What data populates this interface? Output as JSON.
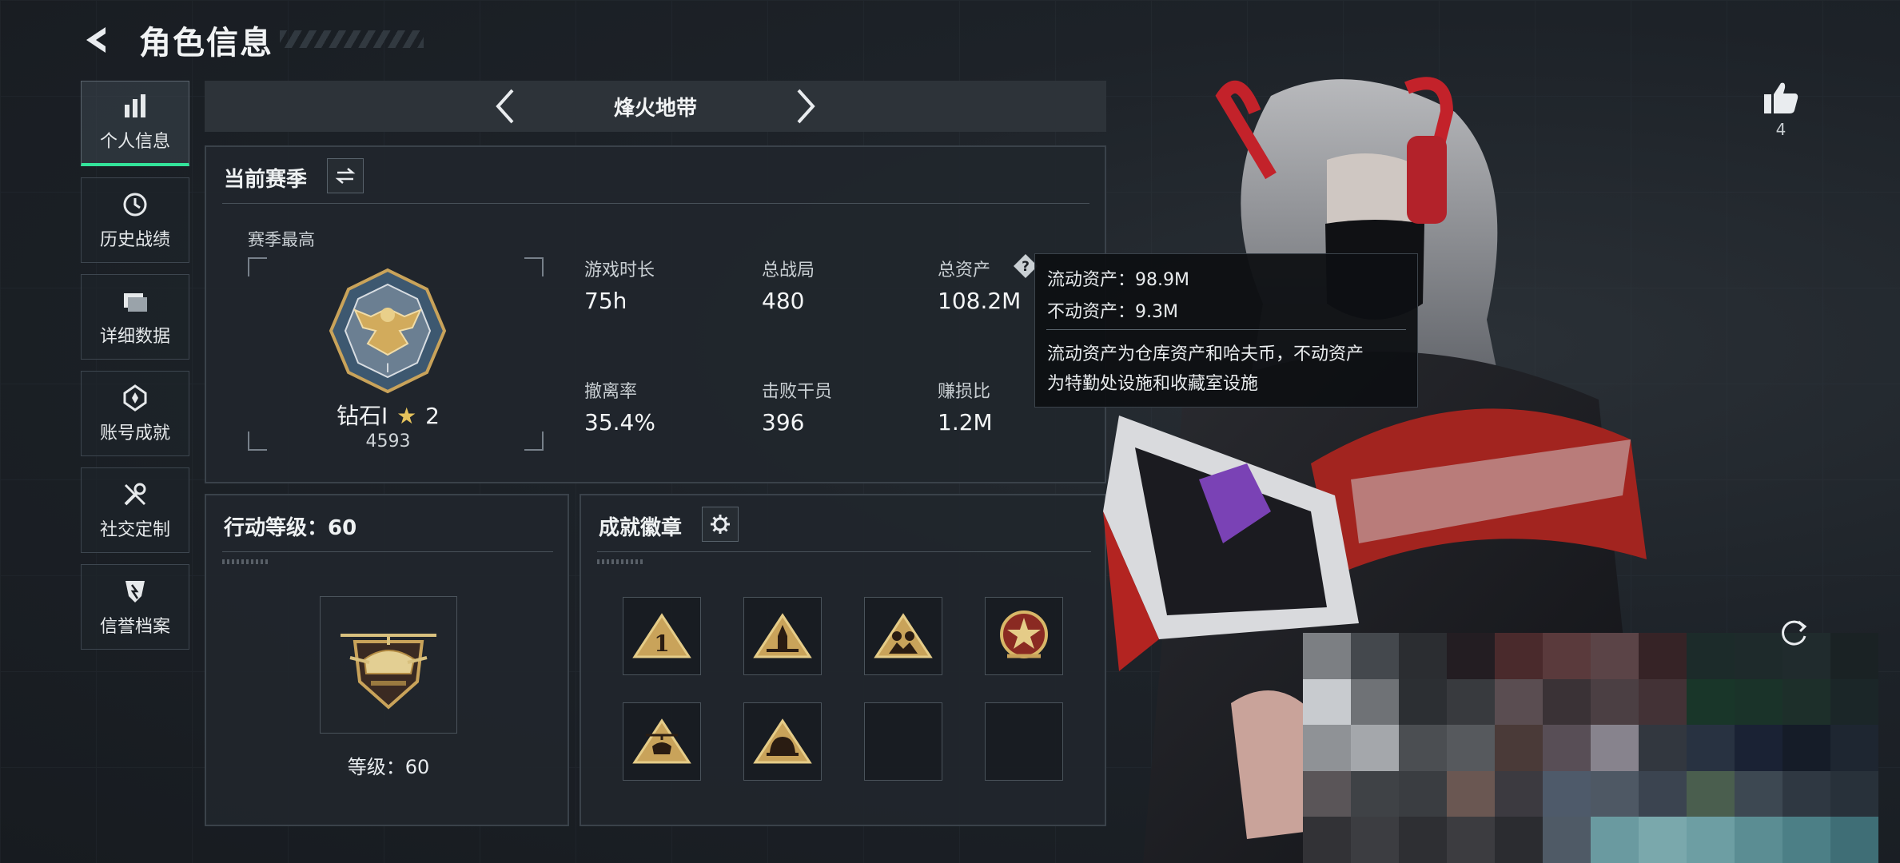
{
  "header": {
    "title": "角色信息"
  },
  "sidebar": {
    "items": [
      {
        "label": "个人信息",
        "icon": "bar-chart-icon",
        "active": true
      },
      {
        "label": "历史战绩",
        "icon": "history-clock-icon",
        "active": false
      },
      {
        "label": "详细数据",
        "icon": "folder-icon",
        "active": false
      },
      {
        "label": "账号成就",
        "icon": "achievement-icon",
        "active": false
      },
      {
        "label": "社交定制",
        "icon": "wrench-icon",
        "active": false
      },
      {
        "label": "信誉档案",
        "icon": "credit-shield-icon",
        "active": false
      }
    ]
  },
  "mode": {
    "title": "烽火地带"
  },
  "season": {
    "title": "当前赛季",
    "best_label": "赛季最高",
    "rank_name": "钻石I",
    "rank_stars": "2",
    "rank_score": "4593",
    "stats": [
      {
        "label": "游戏时长",
        "value": "75h"
      },
      {
        "label": "总战局",
        "value": "480"
      },
      {
        "label": "总资产",
        "value": "108.2M"
      },
      {
        "label": "撤离率",
        "value": "35.4%"
      },
      {
        "label": "击败干员",
        "value": "396"
      },
      {
        "label": "赚损比",
        "value": "1.2M"
      }
    ]
  },
  "tooltip": {
    "line1": "流动资产：98.9M",
    "line2": "不动资产：9.3M",
    "desc1": "流动资产为仓库资产和哈夫币，不动资产",
    "desc2": "为特勤处设施和收藏室设施"
  },
  "action_level": {
    "title": "行动等级：60",
    "level_text": "等级：60"
  },
  "badges": {
    "title": "成就徽章",
    "slots": [
      {
        "icon": "badge-rank1-icon",
        "filled": true
      },
      {
        "icon": "badge-rocket-icon",
        "filled": true
      },
      {
        "icon": "badge-soldiers-icon",
        "filled": true
      },
      {
        "icon": "badge-star-emblem-icon",
        "filled": true
      },
      {
        "icon": "badge-helicopter-icon",
        "filled": true
      },
      {
        "icon": "badge-helmet-icon",
        "filled": true
      },
      {
        "icon": "empty-slot",
        "filled": false
      },
      {
        "icon": "empty-slot",
        "filled": false
      }
    ]
  },
  "like": {
    "count": "4"
  },
  "colors": {
    "accent": "#33e39a",
    "gold": "#c9a35a",
    "panel": "#21262c"
  }
}
